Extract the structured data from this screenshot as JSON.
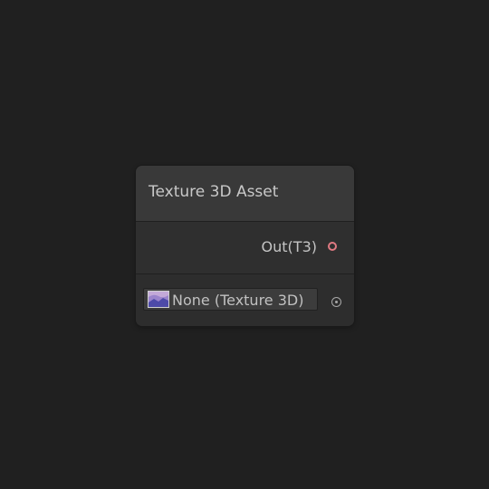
{
  "node": {
    "title": "Texture 3D Asset",
    "output_port": {
      "label": "Out(T3)",
      "color": "#e07a82"
    },
    "input_field": {
      "value": "None (Texture 3D)",
      "icon": "texture-3d-icon"
    }
  }
}
